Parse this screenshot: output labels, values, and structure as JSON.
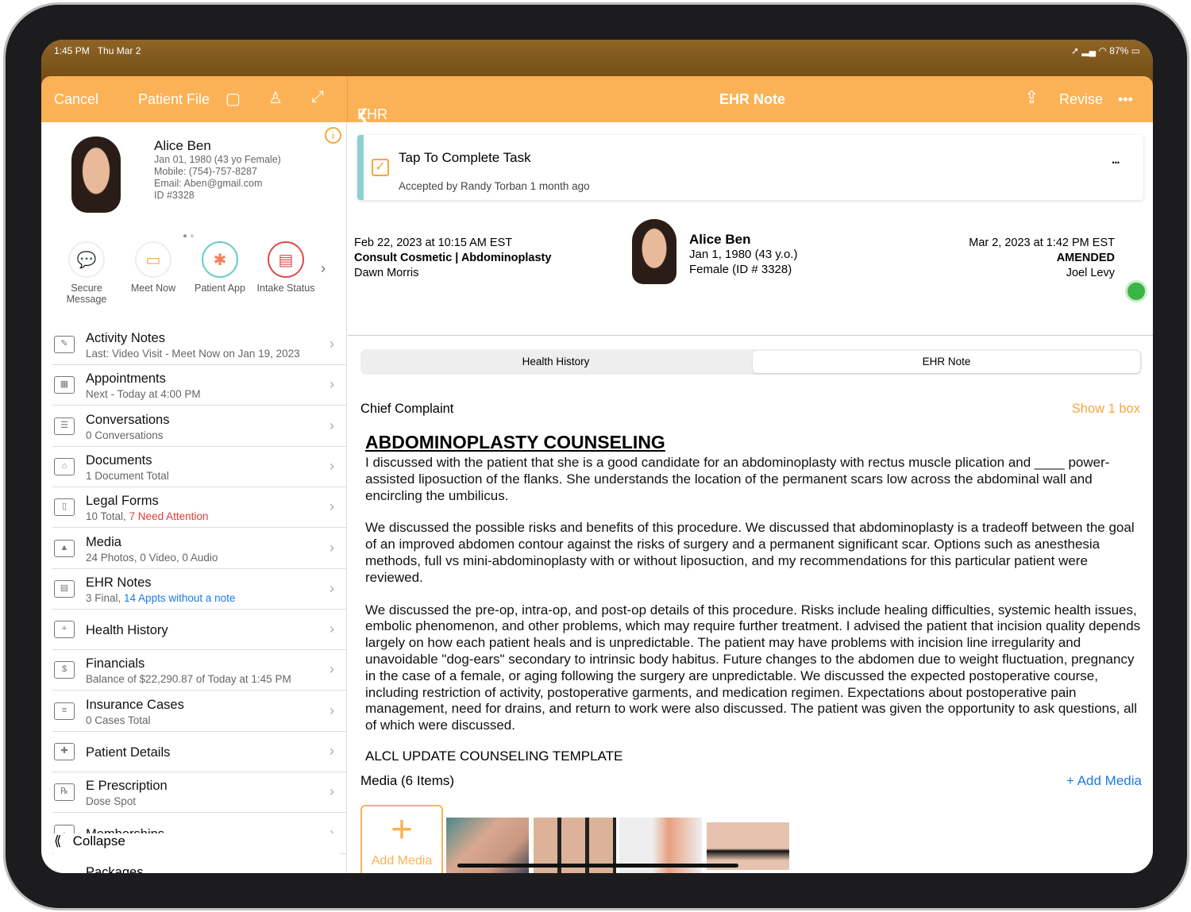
{
  "status": {
    "time": "1:45 PM",
    "date": "Thu Mar 2",
    "battery": "87%"
  },
  "header": {
    "cancel": "Cancel",
    "patient_file": "Patient File",
    "back": "EHR Notes",
    "title": "EHR Note",
    "revise": "Revise",
    "more": "•••"
  },
  "patient": {
    "name": "Alice Ben",
    "dob": "Jan 01, 1980 (43 yo Female)",
    "mobile": "Mobile: (754)-757-8287",
    "email": "Email: Aben@gmail.com",
    "id": "ID #3328"
  },
  "actions": [
    {
      "label": "Secure Message",
      "icon": "💬"
    },
    {
      "label": "Meet Now",
      "icon": "📹"
    },
    {
      "label": "Patient App",
      "icon": "✱"
    },
    {
      "label": "Intake Status",
      "icon": "▤"
    }
  ],
  "menu": [
    {
      "title": "Activity Notes",
      "sub": "Last: Video Visit - Meet Now on Jan 19, 2023",
      "icon": "✎"
    },
    {
      "title": "Appointments",
      "sub": "Next - Today at 4:00 PM",
      "icon": "▦"
    },
    {
      "title": "Conversations",
      "sub": "0 Conversations",
      "icon": "☰"
    },
    {
      "title": "Documents",
      "sub": "1 Document Total",
      "icon": "⌂"
    },
    {
      "title": "Legal Forms",
      "sub": "10 Total, ",
      "sub_alert": "7 Need Attention",
      "icon": "▯"
    },
    {
      "title": "Media",
      "sub": "24 Photos, 0 Video, 0 Audio",
      "icon": "▲"
    },
    {
      "title": "EHR Notes",
      "sub": "3 Final, ",
      "sub_link": "14 Appts without a note",
      "icon": "▤"
    },
    {
      "title": "Health History",
      "sub": "",
      "icon": "+"
    },
    {
      "title": "Financials",
      "sub": "Balance of $22,290.87 of Today at 1:45 PM",
      "icon": "$"
    },
    {
      "title": "Insurance Cases",
      "sub": "0 Cases Total",
      "icon": "≡"
    },
    {
      "title": "Patient Details",
      "sub": "",
      "icon": "✚"
    },
    {
      "title": "E Prescription",
      "sub": "Dose Spot",
      "icon": "℞"
    },
    {
      "title": "Memberships",
      "sub": "",
      "icon": "·"
    }
  ],
  "collapse": "Collapse",
  "packages": "Packages",
  "task": {
    "title": "Tap To Complete Task",
    "sub": "Accepted by Randy Torban 1 month ago",
    "more": "•••"
  },
  "note": {
    "date": "Feb 22, 2023 at 10:15 AM EST",
    "type": "Consult Cosmetic | Abdominoplasty",
    "provider": "Dawn Morris",
    "pname": "Alice Ben",
    "pdob": "Jan 1, 1980 (43 y.o.)",
    "psex": "Female (ID # 3328)",
    "amend_date": "Mar 2, 2023 at 1:42 PM EST",
    "amend_status": "AMENDED",
    "amend_by": "Joel Levy",
    "status_color": "#3bb54a"
  },
  "tabs": [
    "Health History",
    "EHR Note"
  ],
  "chief": "Chief Complaint",
  "show": "Show 1 box",
  "heading": "ABDOMINOPLASTY COUNSELING",
  "paras": [
    "I discussed with the patient that she is a good candidate for an abdominoplasty with rectus muscle plication and ____ power-assisted liposuction of the flanks. She understands the location of the permanent scars low across the abdominal wall and encircling the umbilicus.",
    "We discussed the possible risks and benefits of this procedure. We discussed that abdominoplasty is a tradeoff between the goal of an improved abdomen contour against the risks of surgery and a permanent significant scar. Options such as anesthesia methods, full vs mini-abdominoplasty with or without liposuction, and my recommendations for this particular patient were reviewed.",
    "We discussed the pre-op, intra-op, and post-op details of this procedure. Risks include healing difficulties, systemic health issues, embolic phenomenon, and other problems, which may require further treatment. I advised the patient that incision quality depends largely on how each patient heals and is unpredictable. The patient may have problems with incision line irregularity and unavoidable \"dog-ears\" secondary to intrinsic body habitus. Future changes to the abdomen due to weight fluctuation, pregnancy in the case of a female, or aging following the surgery are unpredictable. We discussed the expected postoperative course, including restriction of activity, postoperative garments, and medication regimen. Expectations about postoperative pain management, need for drains, and return to work were also discussed. The patient was given the opportunity to ask questions, all of which were discussed."
  ],
  "alcl": "ALCL UPDATE COUNSELING TEMPLATE",
  "media": {
    "title": "Media (6 Items)",
    "add_link": "+ Add Media",
    "add_tile": "Add Media",
    "plus": "+"
  },
  "accent": "#fbb257"
}
